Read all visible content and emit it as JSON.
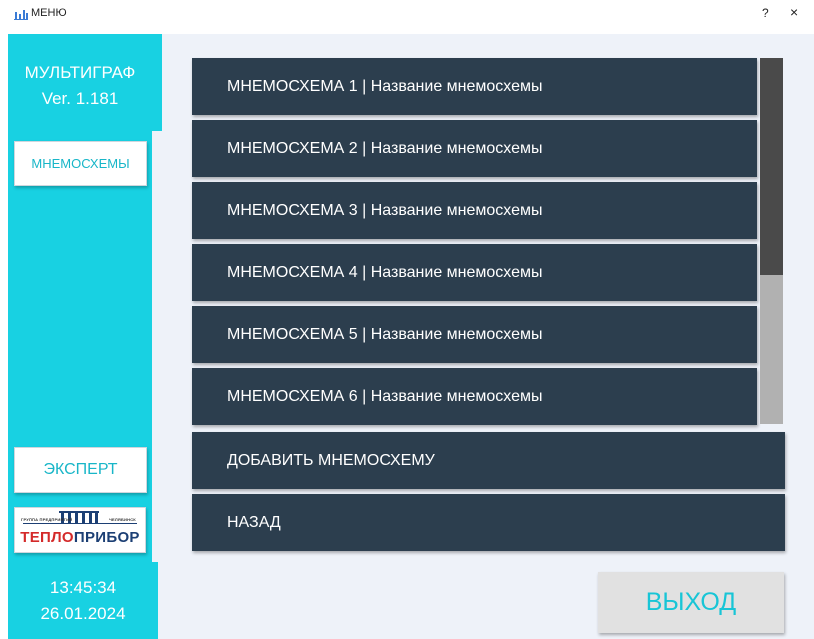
{
  "window": {
    "title": "МЕНЮ",
    "help": "?",
    "close": "×"
  },
  "sidebar": {
    "app_name": "МУЛЬТИГРАФ",
    "version": "Ver. 1.181",
    "mnemo_button": "МНЕМОСХЕМЫ",
    "expert_button": "ЭКСПЕРТ",
    "logo": {
      "small_left": "ГРУППА ПРЕДПРИЯТИЙ",
      "small_right": "ЧЕЛЯБИНСК",
      "part1": "ТЕПЛО",
      "part2": "ПРИБОР"
    },
    "time": "13:45:34",
    "date": "26.01.2024"
  },
  "mnemo_list": [
    "МНЕМОСХЕМА 1 | Название мнемосхемы",
    "МНЕМОСХЕМА 2 | Название мнемосхемы",
    "МНЕМОСХЕМА 3 | Название мнемосхемы",
    "МНЕМОСХЕМА 4 | Название мнемосхемы",
    "МНЕМОСХЕМА 5 | Название мнемосхемы",
    "МНЕМОСХЕМА 6 | Название мнемосхемы"
  ],
  "actions": {
    "add": "ДОБАВИТЬ МНЕМОСХЕМУ",
    "back": "НАЗАД",
    "exit": "ВЫХОД"
  },
  "scroll": {
    "visible_fraction": 0.59,
    "position": 0
  },
  "colors": {
    "accent": "#18d1e2",
    "button_bg": "#2c3e4e",
    "exit_text": "#18c5d6",
    "logo_red": "#d42a2a",
    "logo_blue": "#1c3f74"
  }
}
